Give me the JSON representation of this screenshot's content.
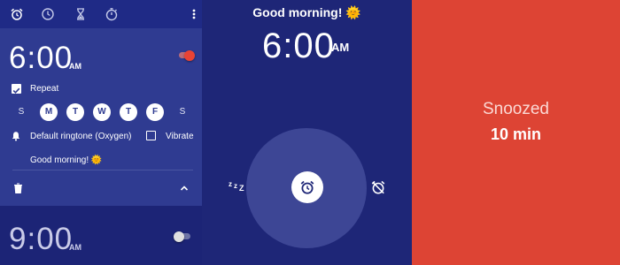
{
  "colors": {
    "panel_dark": "#1c2476",
    "card": "#2f3b91",
    "accent_red": "#dd4434",
    "circle": "#3d4695"
  },
  "tabs": [
    {
      "icon": "alarm-icon"
    },
    {
      "icon": "clock-icon"
    },
    {
      "icon": "hourglass-icon"
    },
    {
      "icon": "stopwatch-icon"
    }
  ],
  "alarm1": {
    "time": "6:00",
    "ampm": "AM",
    "enabled": true,
    "repeat_label": "Repeat",
    "repeat_checked": true,
    "days": [
      {
        "label": "S",
        "selected": false
      },
      {
        "label": "M",
        "selected": true
      },
      {
        "label": "T",
        "selected": true
      },
      {
        "label": "W",
        "selected": true
      },
      {
        "label": "T",
        "selected": true
      },
      {
        "label": "F",
        "selected": true
      },
      {
        "label": "S",
        "selected": false
      }
    ],
    "ringtone": "Default ringtone (Oxygen)",
    "vibrate_label": "Vibrate",
    "vibrate_checked": false,
    "label": "Good morning! 🌞"
  },
  "alarm2": {
    "time": "9:00",
    "ampm": "AM",
    "enabled": false
  },
  "ringing": {
    "title": "Good morning! 🌞",
    "time": "6:00",
    "ampm": "AM",
    "snooze_glyph": "z",
    "snooze_glyph_2": "Z"
  },
  "snoozed": {
    "title": "Snoozed",
    "duration": "10 min"
  }
}
